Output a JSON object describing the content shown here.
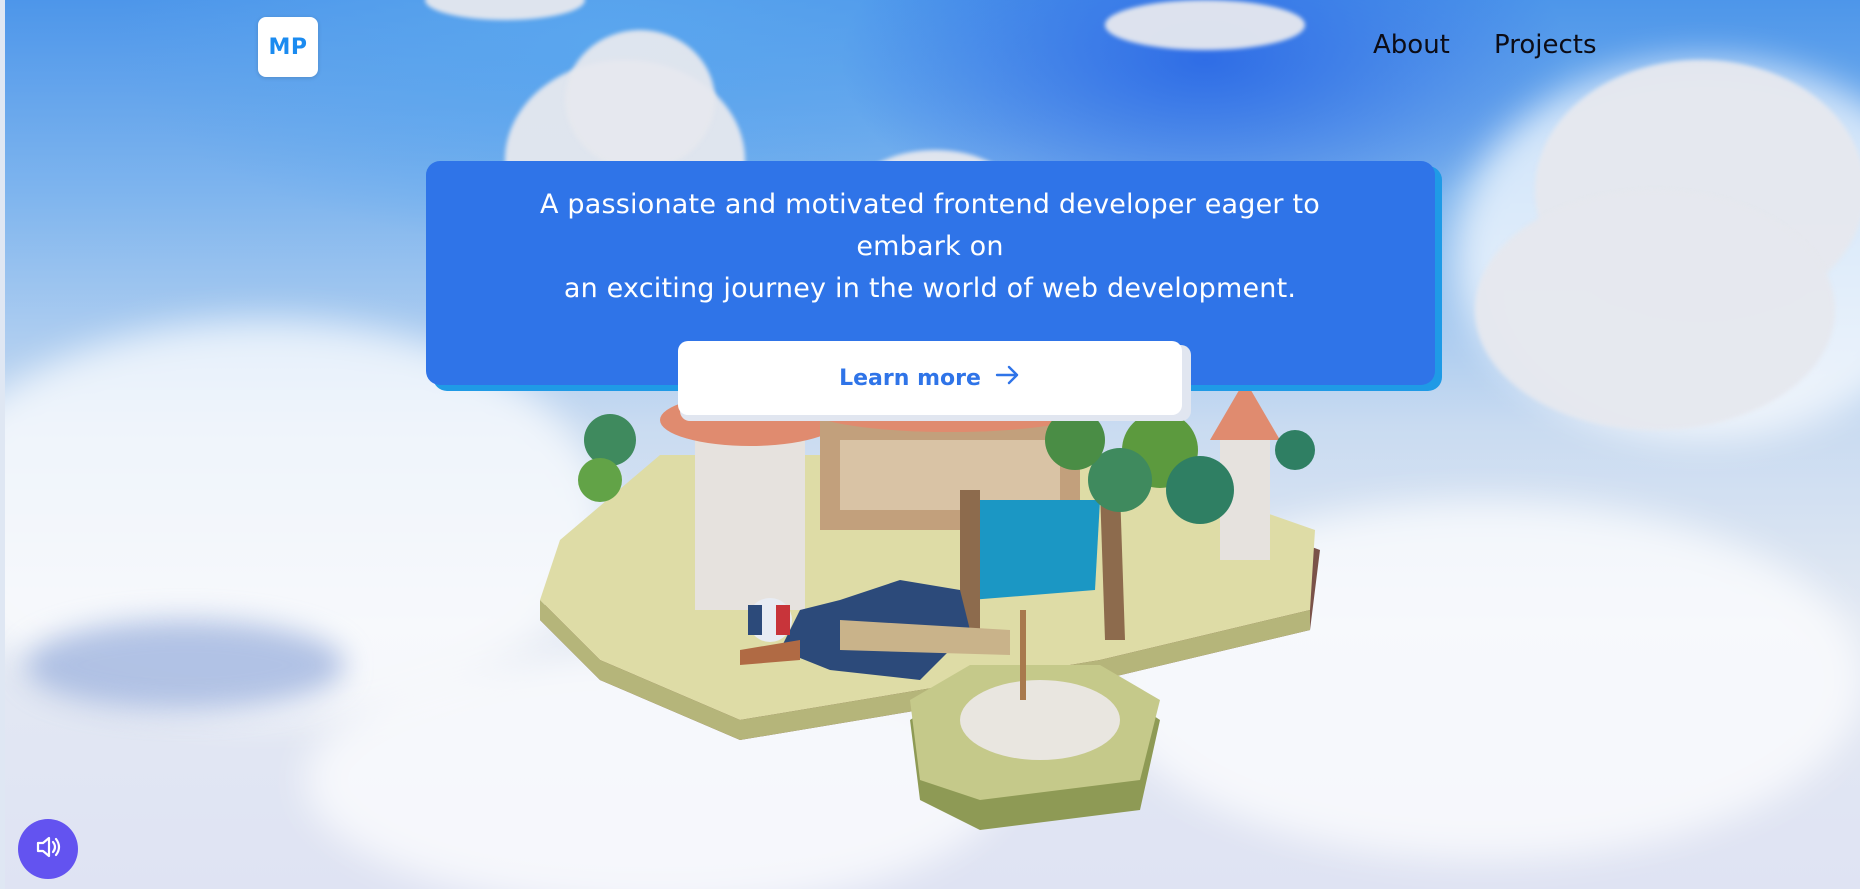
{
  "header": {
    "logo_text": "MP",
    "nav": [
      {
        "label": "About"
      },
      {
        "label": "Projects"
      }
    ]
  },
  "hero": {
    "line1": "A passionate and motivated frontend developer eager to",
    "line2": "embark on",
    "line3": "an exciting journey in the world of web development.",
    "cta_label": "Learn more",
    "cta_icon": "arrow-right-icon"
  },
  "footer": {
    "sound_icon": "speaker-icon"
  },
  "colors": {
    "hero_bg": "#2f74e8",
    "hero_shadow": "#1f9ae6",
    "logo_text": "#1b8bf0",
    "sound_button": "#6353f0"
  }
}
